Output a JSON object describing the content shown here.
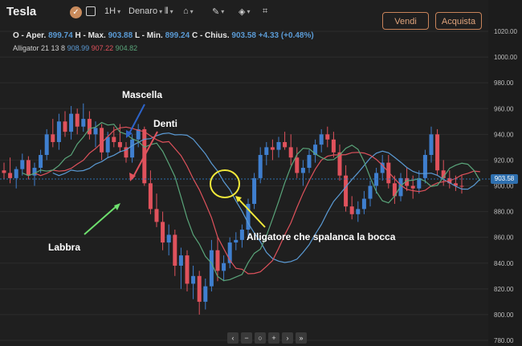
{
  "toolbar": {
    "symbol": "Tesla",
    "interval": "1H",
    "price_type": "Denaro",
    "sell_label": "Vendi",
    "buy_label": "Acquista"
  },
  "ohlc": {
    "open_label": "O - Aper.",
    "open": "899.74",
    "high_label": "H - Max.",
    "high": "903.88",
    "low_label": "L - Min.",
    "low": "899.24",
    "close_label": "C - Chius.",
    "close": "903.58",
    "change": "+4.33 (+0.48%)"
  },
  "indicator": {
    "label": "Alligator 21 13 8",
    "jaw": "908.99",
    "teeth": "907.22",
    "lips": "904.82"
  },
  "price_axis": [
    "1020.00",
    "1000.00",
    "980.00",
    "960.00",
    "940.00",
    "920.00",
    "900.00",
    "880.00",
    "860.00",
    "840.00",
    "820.00",
    "800.00",
    "780.00"
  ],
  "current_price": "903.58",
  "annotations": {
    "jaw": "Mascella",
    "teeth": "Denti",
    "lips": "Labbra",
    "mouth": "Alligatore che spalanca la bocca"
  },
  "colors": {
    "background": "#1f1f1f",
    "up_candle": "#3f7fcf",
    "down_candle": "#e0525c",
    "jaw_line": "#5b9bd5",
    "teeth_line": "#e0525c",
    "lips_line": "#5aa57a",
    "accent": "#c8835a"
  },
  "chart_data": {
    "type": "candlestick",
    "ylim": [
      780,
      1025
    ],
    "ohlc": [
      [
        912,
        918,
        905,
        910
      ],
      [
        910,
        922,
        902,
        906
      ],
      [
        906,
        915,
        898,
        913
      ],
      [
        913,
        925,
        908,
        920
      ],
      [
        920,
        923,
        905,
        908
      ],
      [
        908,
        918,
        900,
        914
      ],
      [
        914,
        928,
        910,
        924
      ],
      [
        924,
        944,
        920,
        940
      ],
      [
        940,
        952,
        930,
        934
      ],
      [
        934,
        956,
        928,
        950
      ],
      [
        950,
        958,
        938,
        942
      ],
      [
        942,
        962,
        936,
        956
      ],
      [
        956,
        960,
        940,
        946
      ],
      [
        946,
        964,
        942,
        952
      ],
      [
        952,
        958,
        936,
        940
      ],
      [
        940,
        950,
        930,
        945
      ],
      [
        945,
        948,
        920,
        926
      ],
      [
        926,
        942,
        922,
        938
      ],
      [
        938,
        946,
        930,
        934
      ],
      [
        934,
        948,
        926,
        930
      ],
      [
        930,
        934,
        918,
        922
      ],
      [
        922,
        940,
        918,
        936
      ],
      [
        936,
        948,
        930,
        944
      ],
      [
        944,
        946,
        900,
        902
      ],
      [
        902,
        912,
        878,
        882
      ],
      [
        882,
        894,
        868,
        872
      ],
      [
        872,
        880,
        850,
        856
      ],
      [
        856,
        870,
        846,
        862
      ],
      [
        862,
        866,
        830,
        838
      ],
      [
        838,
        852,
        820,
        846
      ],
      [
        846,
        850,
        818,
        824
      ],
      [
        824,
        838,
        812,
        830
      ],
      [
        830,
        834,
        800,
        810
      ],
      [
        810,
        828,
        804,
        822
      ],
      [
        822,
        858,
        818,
        850
      ],
      [
        850,
        860,
        826,
        834
      ],
      [
        834,
        846,
        826,
        840
      ],
      [
        840,
        860,
        836,
        856
      ],
      [
        856,
        864,
        850,
        858
      ],
      [
        858,
        870,
        852,
        866
      ],
      [
        866,
        890,
        860,
        886
      ],
      [
        886,
        910,
        882,
        906
      ],
      [
        906,
        930,
        902,
        924
      ],
      [
        924,
        934,
        916,
        930
      ],
      [
        930,
        936,
        920,
        928
      ],
      [
        928,
        938,
        922,
        934
      ],
      [
        934,
        942,
        928,
        930
      ],
      [
        930,
        940,
        916,
        922
      ],
      [
        922,
        930,
        906,
        910
      ],
      [
        910,
        920,
        900,
        914
      ],
      [
        914,
        928,
        910,
        924
      ],
      [
        924,
        936,
        918,
        932
      ],
      [
        932,
        944,
        926,
        940
      ],
      [
        940,
        946,
        930,
        936
      ],
      [
        936,
        942,
        922,
        926
      ],
      [
        926,
        932,
        904,
        908
      ],
      [
        908,
        916,
        880,
        884
      ],
      [
        884,
        892,
        874,
        878
      ],
      [
        878,
        888,
        872,
        882
      ],
      [
        882,
        896,
        878,
        890
      ],
      [
        890,
        904,
        884,
        900
      ],
      [
        900,
        914,
        894,
        910
      ],
      [
        910,
        924,
        904,
        918
      ],
      [
        918,
        924,
        898,
        902
      ],
      [
        902,
        908,
        886,
        892
      ],
      [
        892,
        910,
        888,
        906
      ],
      [
        906,
        914,
        896,
        900
      ],
      [
        900,
        908,
        890,
        898
      ],
      [
        898,
        912,
        894,
        906
      ],
      [
        906,
        928,
        902,
        924
      ],
      [
        924,
        946,
        918,
        940
      ],
      [
        940,
        944,
        908,
        912
      ],
      [
        912,
        920,
        900,
        906
      ],
      [
        906,
        912,
        898,
        902
      ],
      [
        902,
        908,
        896,
        900
      ],
      [
        900,
        908,
        894,
        899.74
      ]
    ]
  }
}
